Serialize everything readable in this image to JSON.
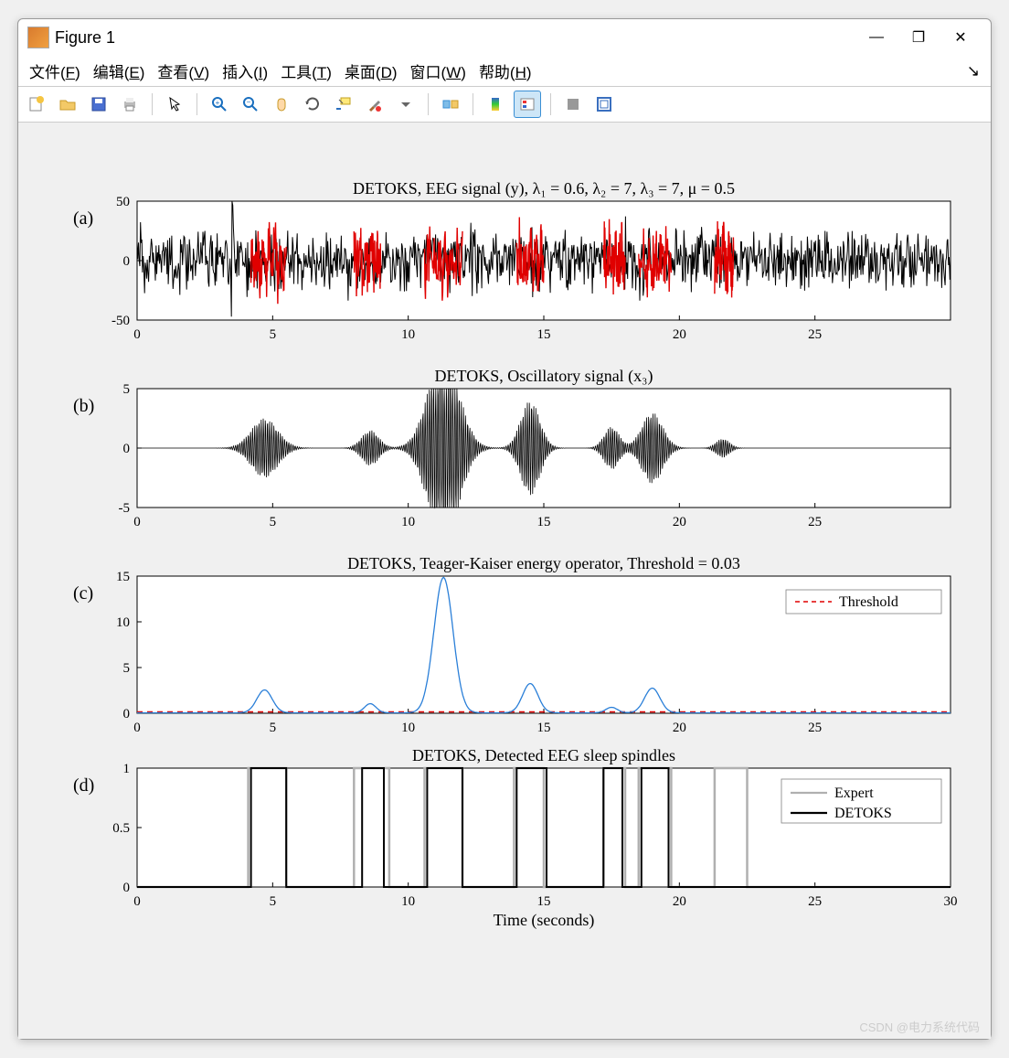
{
  "window": {
    "title": "Figure 1",
    "minimize": "—",
    "restore": "❐",
    "close": "✕"
  },
  "menu": {
    "file": "文件(F)",
    "edit": "编辑(E)",
    "view": "查看(V)",
    "insert": "插入(I)",
    "tools": "工具(T)",
    "desktop": "桌面(D)",
    "window": "窗口(W)",
    "help": "帮助(H)",
    "undock": "↘"
  },
  "watermark": "CSDN @电力系统代码",
  "chart_data": [
    {
      "id": "a",
      "label": "(a)",
      "title": "DETOKS, EEG signal (y), λ₁ = 0.6, λ₂ = 7, λ₃ = 7, μ = 0.5",
      "type": "line",
      "xlim": [
        0,
        30
      ],
      "ylim": [
        -50,
        50
      ],
      "yticks": [
        -50,
        0,
        50
      ],
      "xticks": [
        0,
        5,
        10,
        15,
        20,
        25
      ],
      "highlights": [
        [
          4.2,
          5.5
        ],
        [
          8.0,
          9.0
        ],
        [
          10.6,
          12.0
        ],
        [
          14.0,
          15.0
        ],
        [
          17.2,
          18.0
        ],
        [
          18.5,
          19.7
        ],
        [
          21.3,
          22.0
        ]
      ]
    },
    {
      "id": "b",
      "label": "(b)",
      "title": "DETOKS, Oscillatory signal (x₃)",
      "type": "line",
      "xlim": [
        0,
        30
      ],
      "ylim": [
        -5,
        5
      ],
      "yticks": [
        -5,
        0,
        5
      ],
      "xticks": [
        0,
        5,
        10,
        15,
        20,
        25
      ],
      "bursts": [
        {
          "center": 4.7,
          "width": 1.4,
          "amp": 2.5
        },
        {
          "center": 8.6,
          "width": 0.9,
          "amp": 1.5
        },
        {
          "center": 11.3,
          "width": 1.6,
          "amp": 8
        },
        {
          "center": 14.5,
          "width": 1.0,
          "amp": 4
        },
        {
          "center": 17.5,
          "width": 0.8,
          "amp": 1.8
        },
        {
          "center": 19.0,
          "width": 1.1,
          "amp": 3
        },
        {
          "center": 21.6,
          "width": 0.7,
          "amp": 0.8
        }
      ]
    },
    {
      "id": "c",
      "label": "(c)",
      "title": "DETOKS, Teager-Kaiser energy operator, Threshold = 0.03",
      "type": "line",
      "xlim": [
        0,
        30
      ],
      "ylim": [
        0,
        15
      ],
      "yticks": [
        0,
        5,
        10,
        15
      ],
      "xticks": [
        0,
        5,
        10,
        15,
        20,
        25
      ],
      "threshold": 0.03,
      "legend": [
        {
          "label": "Threshold",
          "color": "#e00000",
          "dash": true
        }
      ],
      "peaks": [
        {
          "center": 4.7,
          "amp": 2.5,
          "width": 0.8
        },
        {
          "center": 8.6,
          "amp": 1,
          "width": 0.6
        },
        {
          "center": 11.3,
          "amp": 14.8,
          "width": 1.0
        },
        {
          "center": 14.5,
          "amp": 3.2,
          "width": 0.8
        },
        {
          "center": 17.5,
          "amp": 0.6,
          "width": 0.6
        },
        {
          "center": 19.0,
          "amp": 2.7,
          "width": 0.8
        }
      ]
    },
    {
      "id": "d",
      "label": "(d)",
      "title": "DETOKS, Detected EEG sleep spindles",
      "type": "step",
      "xlim": [
        0,
        30
      ],
      "ylim": [
        0,
        1
      ],
      "yticks": [
        0,
        0.5,
        1
      ],
      "xticks": [
        0,
        5,
        10,
        15,
        20,
        25,
        30
      ],
      "xlabel": "Time (seconds)",
      "legend": [
        {
          "label": "Expert",
          "color": "#b0b0b0"
        },
        {
          "label": "DETOKS",
          "color": "#000000"
        }
      ],
      "expert_intervals": [
        [
          4.1,
          5.5
        ],
        [
          8.0,
          9.3
        ],
        [
          10.6,
          12.0
        ],
        [
          13.9,
          15.0
        ],
        [
          17.2,
          18.0
        ],
        [
          18.5,
          19.7
        ],
        [
          21.3,
          22.5
        ]
      ],
      "detoks_intervals": [
        [
          4.2,
          5.5
        ],
        [
          8.3,
          9.1
        ],
        [
          10.7,
          12.0
        ],
        [
          14.0,
          15.1
        ],
        [
          17.2,
          17.9
        ],
        [
          18.6,
          19.6
        ]
      ]
    }
  ]
}
